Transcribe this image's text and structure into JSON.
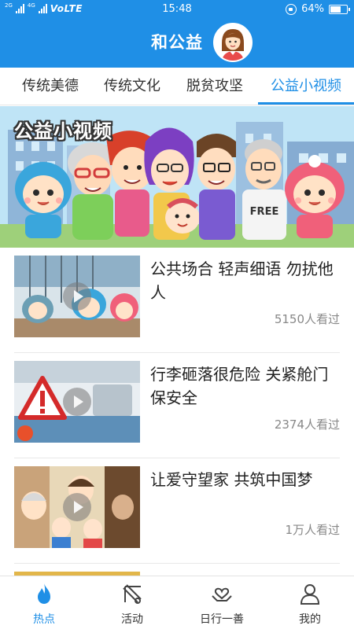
{
  "status_bar": {
    "network_left": "2G",
    "network_right": "4G",
    "volte": "VoLTE",
    "time": "15:48",
    "battery": "64%",
    "battery_level": 0.64
  },
  "header": {
    "title": "和公益",
    "avatar_icon": "user-avatar"
  },
  "tabs": [
    {
      "label": "传统美德",
      "active": false
    },
    {
      "label": "传统文化",
      "active": false
    },
    {
      "label": "脱贫攻坚",
      "active": false
    },
    {
      "label": "公益小视频",
      "active": true
    }
  ],
  "banner": {
    "title": "公益小视频",
    "shirt_text": "FREE"
  },
  "videos": [
    {
      "title": "公共场合 轻声细语 勿扰他人",
      "views": "5150人看过"
    },
    {
      "title": "行李砸落很危险 关紧舱门保安全",
      "views": "2374人看过"
    },
    {
      "title": "让爱守望家 共筑中国梦",
      "views": "1万人看过"
    }
  ],
  "bottom_nav": [
    {
      "label": "热点",
      "icon": "flame-icon",
      "active": true
    },
    {
      "label": "活动",
      "icon": "activity-icon",
      "active": false
    },
    {
      "label": "日行一善",
      "icon": "heart-hands-icon",
      "active": false
    },
    {
      "label": "我的",
      "icon": "person-icon",
      "active": false
    }
  ],
  "colors": {
    "accent": "#1f8fe6",
    "text": "#222222",
    "muted": "#888888"
  }
}
